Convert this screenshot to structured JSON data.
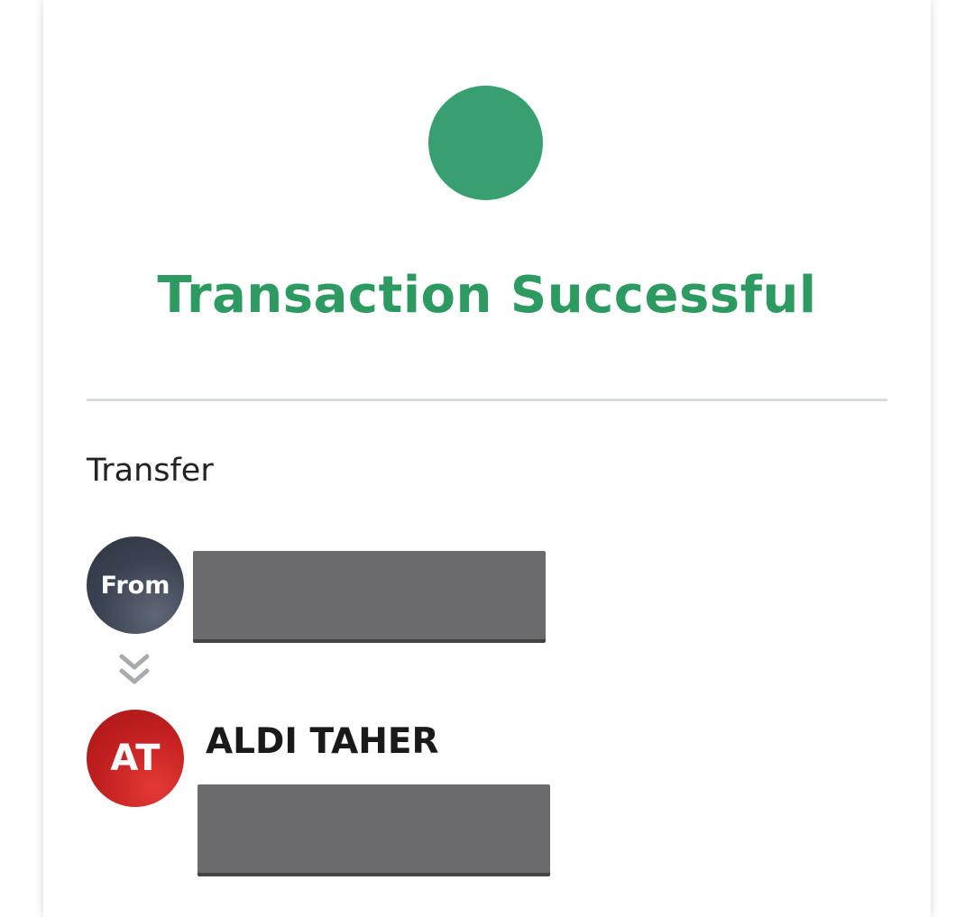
{
  "status": {
    "title": "Transaction Successful",
    "color": "#38a070",
    "title_color": "#2d9a62"
  },
  "transfer": {
    "section_label": "Transfer",
    "from": {
      "avatar_label": "From",
      "account_redacted": true
    },
    "to": {
      "avatar_initials": "AT",
      "name": "ALDI TAHER",
      "account_redacted": true
    },
    "arrow_icon": "double-chevron-down-icon"
  }
}
